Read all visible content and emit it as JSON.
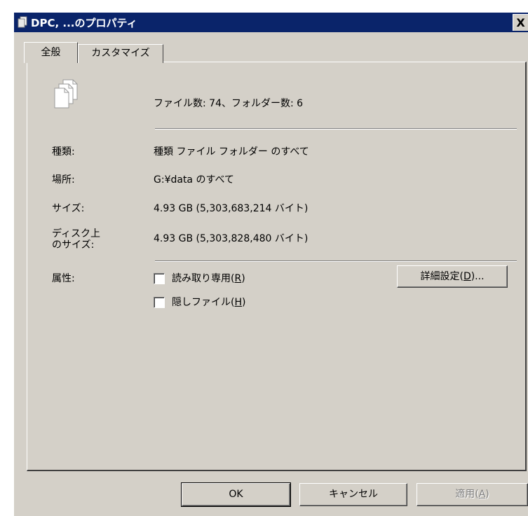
{
  "window": {
    "title": "DPC, ...のプロパティ",
    "close_label": "X"
  },
  "tabs": [
    {
      "label": "全般"
    },
    {
      "label": "カスタマイズ"
    }
  ],
  "summary": {
    "text": "ファイル数: 74、フォルダー数: 6"
  },
  "props": {
    "type": {
      "label": "種類:",
      "value": "種類 ファイル フォルダー のすべて"
    },
    "location": {
      "label": "場所:",
      "value": "G:¥data のすべて"
    },
    "size": {
      "label": "サイズ:",
      "value": "4.93 GB (5,303,683,214 バイト)"
    },
    "disk": {
      "label_line1": "ディスク上",
      "label_line2": "のサイズ:",
      "value": "4.93 GB (5,303,828,480 バイト)"
    }
  },
  "attributes": {
    "label": "属性:",
    "readonly": {
      "text": "読み取り専用(",
      "key": "R",
      "suffix": ")",
      "checked": false
    },
    "hidden": {
      "text": "隠しファイル(",
      "key": "H",
      "suffix": ")",
      "checked": false
    },
    "advanced": {
      "text": "詳細設定(",
      "key": "D",
      "suffix": ")..."
    }
  },
  "buttons": {
    "ok": "OK",
    "cancel": "キャンセル",
    "apply": {
      "text": "適用(",
      "key": "A",
      "suffix": ")",
      "enabled": false
    }
  },
  "colors": {
    "titlebar": "#0a246a",
    "face": "#d4d0c8"
  },
  "icons": {
    "title": "folder-properties-icon",
    "files": "multiple-files-icon"
  }
}
